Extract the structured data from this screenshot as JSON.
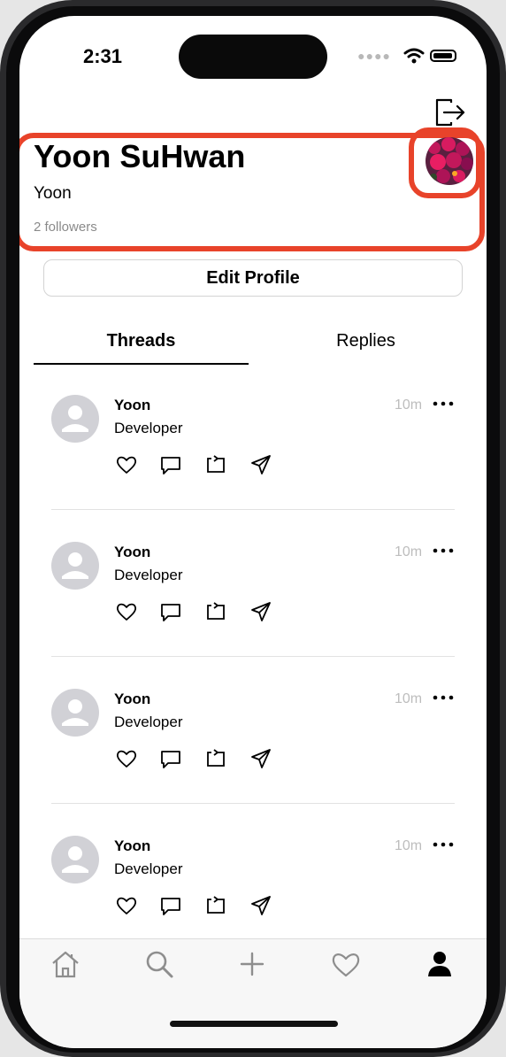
{
  "status_bar": {
    "time": "2:31"
  },
  "profile": {
    "full_name": "Yoon SuHwan",
    "username": "Yoon",
    "followers": "2 followers",
    "edit_label": "Edit Profile"
  },
  "tabs": [
    {
      "label": "Threads",
      "selected": true
    },
    {
      "label": "Replies",
      "selected": false
    }
  ],
  "threads": [
    {
      "user": "Yoon",
      "text": "Developer",
      "time": "10m"
    },
    {
      "user": "Yoon",
      "text": "Developer",
      "time": "10m"
    },
    {
      "user": "Yoon",
      "text": "Developer",
      "time": "10m"
    },
    {
      "user": "Yoon",
      "text": "Developer",
      "time": "10m"
    }
  ],
  "tab_bar": {
    "items": [
      "home-icon",
      "search-icon",
      "plus-icon",
      "heart-icon",
      "person-icon"
    ],
    "selected": "person-icon"
  },
  "colors": {
    "highlight": "#e8432a",
    "secondary_text": "#8a8a8a",
    "muted_text": "#bdbdbd"
  }
}
